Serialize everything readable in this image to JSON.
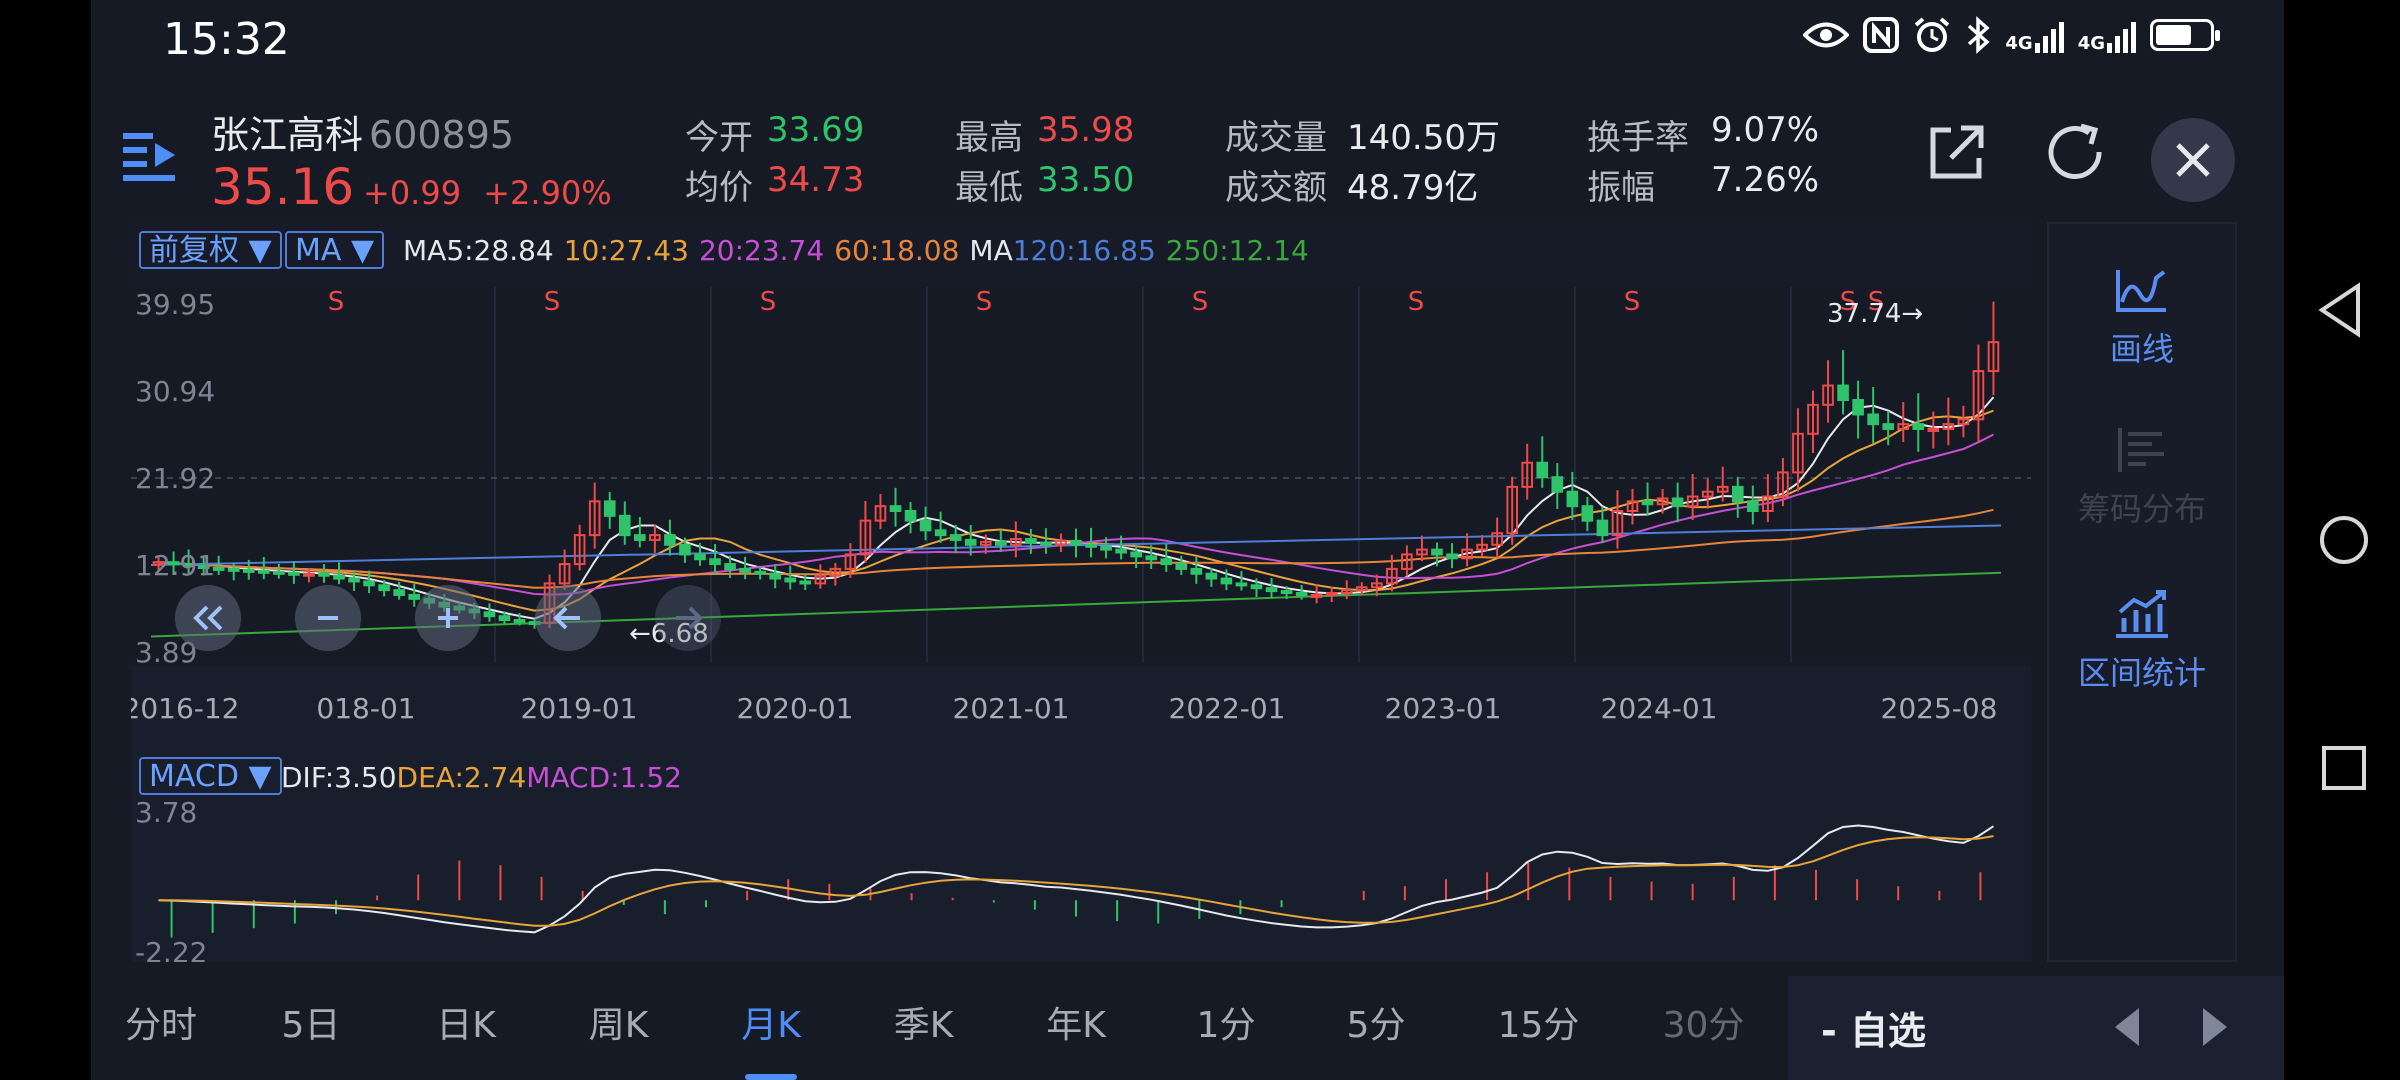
{
  "status": {
    "time": "15:32",
    "net1": "4G",
    "net2": "4G"
  },
  "stock": {
    "name": "张江高科",
    "code": "600895",
    "price": "35.16",
    "change": "+0.99",
    "change_pct": "+2.90%",
    "quotes": [
      {
        "label": "今开",
        "value": "33.69",
        "color": "g"
      },
      {
        "label": "均价",
        "value": "34.73",
        "color": "r"
      },
      {
        "label": "最高",
        "value": "35.98",
        "color": "r"
      },
      {
        "label": "最低",
        "value": "33.50",
        "color": "g"
      },
      {
        "label": "成交量",
        "value": "140.50万",
        "color": "w"
      },
      {
        "label": "成交额",
        "value": "48.79亿",
        "color": "w"
      },
      {
        "label": "换手率",
        "value": "9.07%",
        "color": "w"
      },
      {
        "label": "振幅",
        "value": "7.26%",
        "color": "w"
      }
    ]
  },
  "toolbar": {
    "fq_label": "前复权 ▼",
    "ind_label": "MA ▼"
  },
  "ma": [
    {
      "text": "MA5:28.84",
      "color": "#e6e8ec"
    },
    {
      "text": "10:27.43",
      "color": "#e8a33a"
    },
    {
      "text": "20:23.74",
      "color": "#c64fd6"
    },
    {
      "text": "60:18.08",
      "color": "#e8843a"
    },
    {
      "text": "MA",
      "color": "#e6e8ec"
    },
    {
      "text": "120:16.85",
      "color": "#4f7ed8"
    },
    {
      "text": "250:12.14",
      "color": "#3aa83a"
    }
  ],
  "macd_labels": {
    "tag": "MACD ▼",
    "dif": "DIF:3.50",
    "dea": "DEA:2.74",
    "macd": "MACD:1.52"
  },
  "chart_data": {
    "type": "candlestick",
    "y_ticks": [
      "39.95",
      "30.94",
      "21.92",
      "12.91",
      "3.89"
    ],
    "ylim": [
      3.89,
      39.95
    ],
    "x_ticks": [
      "2016-12",
      "018-01",
      "2019-01",
      "2020-01",
      "2021-01",
      "2022-01",
      "2023-01",
      "2024-01",
      "2025-08"
    ],
    "high_annotation": "37.74",
    "low_annotation": "6.68",
    "signal_letter": "S",
    "macd_y_ticks": [
      "3.78",
      "-2.22"
    ],
    "macd_ylim": [
      -2.22,
      3.78
    ],
    "series": {
      "close": [
        13.2,
        13.0,
        12.8,
        12.6,
        12.5,
        12.4,
        12.3,
        12.2,
        12.1,
        12.0,
        12.0,
        11.8,
        11.5,
        11.2,
        10.8,
        10.3,
        9.8,
        9.4,
        9.0,
        8.6,
        8.3,
        8.0,
        7.6,
        7.2,
        7.0,
        6.9,
        11.0,
        13.0,
        16.0,
        19.5,
        18.0,
        16.0,
        15.5,
        16.0,
        15.0,
        14.0,
        13.5,
        13.0,
        12.5,
        12.2,
        12.0,
        11.5,
        11.2,
        11.0,
        11.8,
        12.5,
        14.0,
        17.5,
        19.0,
        18.5,
        17.5,
        16.5,
        16.0,
        15.5,
        15.0,
        15.3,
        15.0,
        15.6,
        15.2,
        15.0,
        15.4,
        15.0,
        14.8,
        14.5,
        14.2,
        13.8,
        13.5,
        13.0,
        12.5,
        12.0,
        11.5,
        11.0,
        10.8,
        10.5,
        10.2,
        10.0,
        9.8,
        9.8,
        10.0,
        10.3,
        10.6,
        11.0,
        12.5,
        14.0,
        14.5,
        14.0,
        13.6,
        14.5,
        15.0,
        16.2,
        21.0,
        23.5,
        22.0,
        20.5,
        19.0,
        17.5,
        16.0,
        18.5,
        19.5,
        19.2,
        19.8,
        19.0,
        20.0,
        20.5,
        21.0,
        19.5,
        18.5,
        20.0,
        22.5,
        26.5,
        29.5,
        31.5,
        30.0,
        28.5,
        27.5,
        27.0,
        27.5,
        27.0,
        27.0,
        27.5,
        28.0,
        33.0,
        36.0
      ],
      "macd_hist_sample": [
        -1.6,
        -1.4,
        -1.2,
        -1.0,
        -0.6,
        0.2,
        1.1,
        1.7,
        1.5,
        1.0,
        0.4,
        -0.2,
        -0.6,
        -0.3,
        0.4,
        0.9,
        0.7,
        0.5,
        0.3,
        0.1,
        -0.1,
        -0.4,
        -0.7,
        -0.9,
        -1.0,
        -0.8,
        -0.6,
        -0.3,
        0.0,
        0.4,
        0.6,
        0.9,
        1.2,
        1.6,
        1.4,
        1.0,
        0.8,
        0.7,
        1.0,
        1.5,
        1.3,
        0.9,
        0.6,
        0.4,
        1.2
      ]
    }
  },
  "right_panel": {
    "draw": "画线",
    "chips": "筹码分布",
    "stats": "区间统计"
  },
  "tabs": [
    "分时",
    "5日",
    "日K",
    "周K",
    "月K",
    "季K",
    "年K",
    "1分",
    "5分",
    "15分",
    "30分"
  ],
  "active_tab": "月K",
  "favorite": "- 自选",
  "colors": {
    "up": "#ee4a4a",
    "down": "#2fc36a",
    "accent": "#4f8df7",
    "bg": "#151a25"
  }
}
